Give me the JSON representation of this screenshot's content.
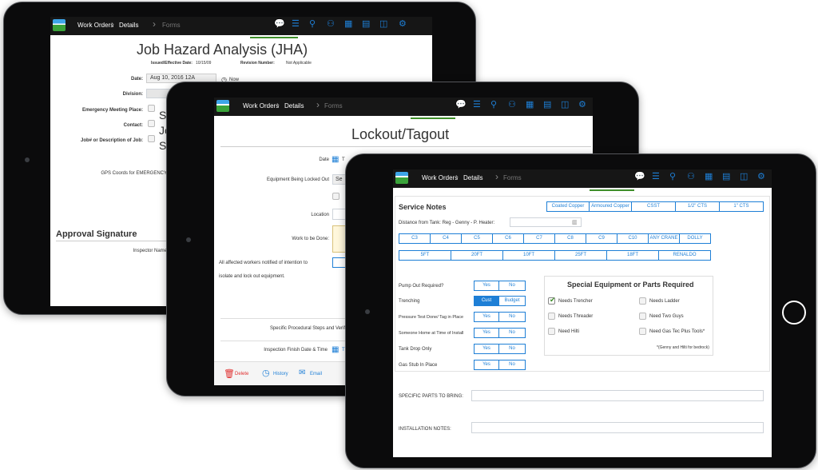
{
  "colors": {
    "accent": "#1e7fd6",
    "navbar": "#161616",
    "underline": "#3f8f2a",
    "delete": "#e03030"
  },
  "nav": {
    "work_orders": "Work Orders",
    "details": "Details",
    "forms": "Forms"
  },
  "nav_icons": [
    "chat-icon",
    "list-icon",
    "map-pin-icon",
    "people-icon",
    "grid-icon",
    "calculator-icon",
    "presentation-icon",
    "gear-icon"
  ],
  "jha": {
    "title": "Job Hazard Analysis (JHA)",
    "issued_label": "Issued/Effective Date:",
    "issued_value": "10/15/09",
    "revision_label": "Revision Number:",
    "revision_value": "Not Applicable",
    "date_label": "Date:",
    "date_value": "Aug 10, 2016 12A",
    "now_label": "Now",
    "division_label": "Division:",
    "meeting_label": "Emergency Meeting Place:",
    "meeting_value": "Sc",
    "contact_label": "Contact:",
    "contact_value": "Jo",
    "job_label": "Job# or Description of Job:",
    "job_value": "Su",
    "gps_label": "GPS Coords for EMERGENCY",
    "approval_heading": "Approval Signature",
    "inspector_label": "Inspector Name"
  },
  "lockout": {
    "title": "Lockout/Tagout",
    "date_label": "Date",
    "date_value": "T",
    "equipment_label": "Equipment Being Locked Out",
    "equipment_value": "Se",
    "location_label": "Location",
    "work_label": "Work to be Done:",
    "notified_line1": "All affected workers notified of intention to",
    "notified_line2": "isolate and lock out equipment.",
    "procedural_label": "Specific Procedural Steps and Verif",
    "finish_label": "Inspection Finish Date & Time",
    "finish_value": "T",
    "delete_label": "Delete",
    "history_label": "History",
    "email_label": "Email"
  },
  "service": {
    "title": "Service Notes",
    "pipe_types": [
      "Coated Copper",
      "Armoured Copper",
      "CSST",
      "1/2\" CTS",
      "1\" CTS"
    ],
    "distance_label": "Distance from Tank: Reg - Genny - P. Heater:",
    "size_codes": [
      "C3",
      "C4",
      "C5",
      "C6",
      "C7",
      "C8",
      "C9",
      "C10",
      "ANY CRANE",
      "DOLLY"
    ],
    "lengths": [
      "5FT",
      "20FT",
      "10FT",
      "25FT",
      "18FT",
      "RENALDO"
    ],
    "questions": [
      {
        "label": "Pump Out Required?",
        "a": "Yes",
        "b": "No",
        "selected": ""
      },
      {
        "label": "Trenching",
        "a": "Cust",
        "b": "Budget",
        "selected": "a"
      },
      {
        "label": "Pressure Test Done/ Tag in Place",
        "a": "Yes",
        "b": "No",
        "selected": ""
      },
      {
        "label": "Someone Home at Time of Install",
        "a": "Yes",
        "b": "No",
        "selected": ""
      },
      {
        "label": "Tank Drop Only",
        "a": "Yes",
        "b": "No",
        "selected": ""
      },
      {
        "label": "Gas Stub In Place",
        "a": "Yes",
        "b": "No",
        "selected": ""
      }
    ],
    "special_title": "Special Equipment or Parts Required",
    "special_items": [
      {
        "label": "Needs Trencher",
        "checked": true
      },
      {
        "label": "Needs Ladder",
        "checked": false
      },
      {
        "label": "Needs Threader",
        "checked": false
      },
      {
        "label": "Need Two Guys",
        "checked": false
      },
      {
        "label": "Need Hilti",
        "checked": false
      },
      {
        "label": "Need Gas Tec Plus Tools*",
        "checked": false
      }
    ],
    "special_note": "*(Genny and Hilti for bedrock)",
    "parts_label": "SPECIFIC PARTS TO BRING:",
    "install_label": "INSTALLATION NOTES:"
  }
}
